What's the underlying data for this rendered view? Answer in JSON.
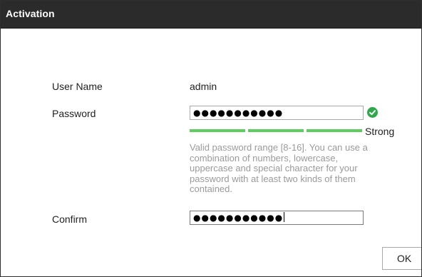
{
  "dialog": {
    "title": "Activation"
  },
  "form": {
    "username": {
      "label": "User Name",
      "value": "admin"
    },
    "password": {
      "label": "Password",
      "masked_value": "●●●●●●●●●●●",
      "valid_icon": "check-circle-icon",
      "strength": {
        "label": "Strong",
        "level": 3,
        "max_level": 3,
        "color": "#5cce5c"
      },
      "hint": "Valid password range [8-16]. You can use a combination of numbers, lowercase, uppercase and special character for your password with at least two kinds of them contained."
    },
    "confirm": {
      "label": "Confirm",
      "masked_value": "●●●●●●●●●●●"
    }
  },
  "buttons": {
    "ok_label": "OK"
  },
  "colors": {
    "titlebar": "#2b2b2b",
    "success": "#2ea84a",
    "strength_bar": "#5cce5c"
  }
}
